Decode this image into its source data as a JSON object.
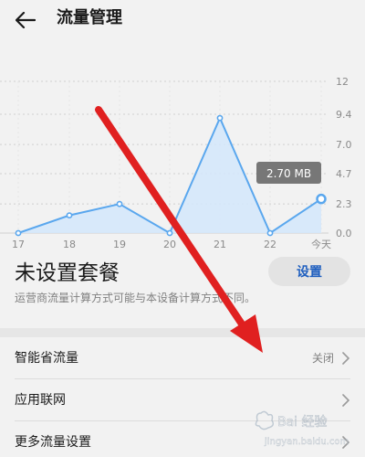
{
  "header": {
    "title": "流量管理",
    "back_icon": "arrow-left-icon"
  },
  "chart_data": {
    "type": "area",
    "categories": [
      "17",
      "18",
      "19",
      "20",
      "21",
      "22",
      "今天"
    ],
    "values": [
      0.0,
      1.4,
      2.3,
      0.0,
      9.1,
      0.0,
      2.7
    ],
    "y_ticks": [
      "0.0",
      "2.3",
      "4.7",
      "7.0",
      "9.4",
      "12"
    ],
    "ylim": [
      0,
      12
    ],
    "tooltip": "2.70 MB",
    "grid": true,
    "colors": {
      "line": "#5aa7ee",
      "fill": "#d3e7fb",
      "grid": "#d0d0d0",
      "tooltip_bg": "#777777"
    }
  },
  "plan": {
    "title": "未设置套餐",
    "setup_label": "设置",
    "description": "运营商流量计算方式可能与本设备计算方式不同。"
  },
  "settings": [
    {
      "label": "智能省流量",
      "value": "关闭",
      "icon": "chevron-right-icon"
    },
    {
      "label": "应用联网",
      "value": "",
      "icon": "chevron-right-icon"
    },
    {
      "label": "更多流量设置",
      "value": "",
      "icon": "chevron-right-icon"
    }
  ],
  "watermark": {
    "text": "Bai 经验",
    "url": "jingyan.baidu.com"
  },
  "annotation": {
    "color": "#e02020"
  }
}
